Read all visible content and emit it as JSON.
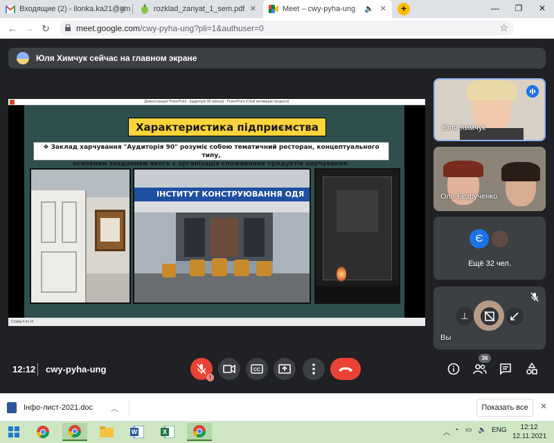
{
  "browser": {
    "tabs": [
      {
        "label": "Входящие (2) - ilonka.ka21@gm",
        "icon": "gmail-icon"
      },
      {
        "label": "rozklad_zanyat_1_sem.pdf",
        "icon": "pdf-icon"
      },
      {
        "label": "Meet – cwy-pyha-ung",
        "icon": "meet-icon",
        "active": true
      }
    ],
    "url_host": "meet.google.com",
    "url_path": "/cwy-pyha-ung?pli=1&authuser=0"
  },
  "meet": {
    "banner_text": "Юля Химчук сейчас на главном экране",
    "presentation": {
      "window_title": "Демонстрация PowerPoint - [аудиторія 90 химчук] - PowerPoint (Сбой активации продукта)",
      "slide_title": "Характеристика підприємства",
      "slide_body_line1": "❖ Заклад харчування \"Аудиторія 90\" розуміє собою тематичний ресторан, концептуального типу,",
      "slide_body_line2": "основним завданням якого є організація споживання продуктів харчування.",
      "building_sign": "ІНСТИТУТ КОНСТРУЮВАННЯ ОДЯ",
      "status_text": "Слайд 4 из 15"
    },
    "participants": [
      {
        "name": "Юля Химчук",
        "speaking": true
      },
      {
        "name": "Оля Безрученко"
      }
    ],
    "more": {
      "letter": "Є",
      "label": "Ещё 32 чел."
    },
    "self_name": "Вы",
    "time": "12:12",
    "meeting_code": "cwy-pyha-ung",
    "participant_count": "36"
  },
  "downloads": {
    "file_name": "Інфо-лист-2021.doc",
    "show_all": "Показать все"
  },
  "taskbar": {
    "lang": "ENG",
    "time": "12:12",
    "date": "12.11.2021"
  },
  "colors": {
    "meet_bg": "#202124",
    "tile_bg": "#3c4043",
    "end_call": "#ea4335",
    "accent_blue": "#1a73e8",
    "slide_title_bg": "#ffd43b",
    "taskbar_bg": "#cfe6c4"
  }
}
